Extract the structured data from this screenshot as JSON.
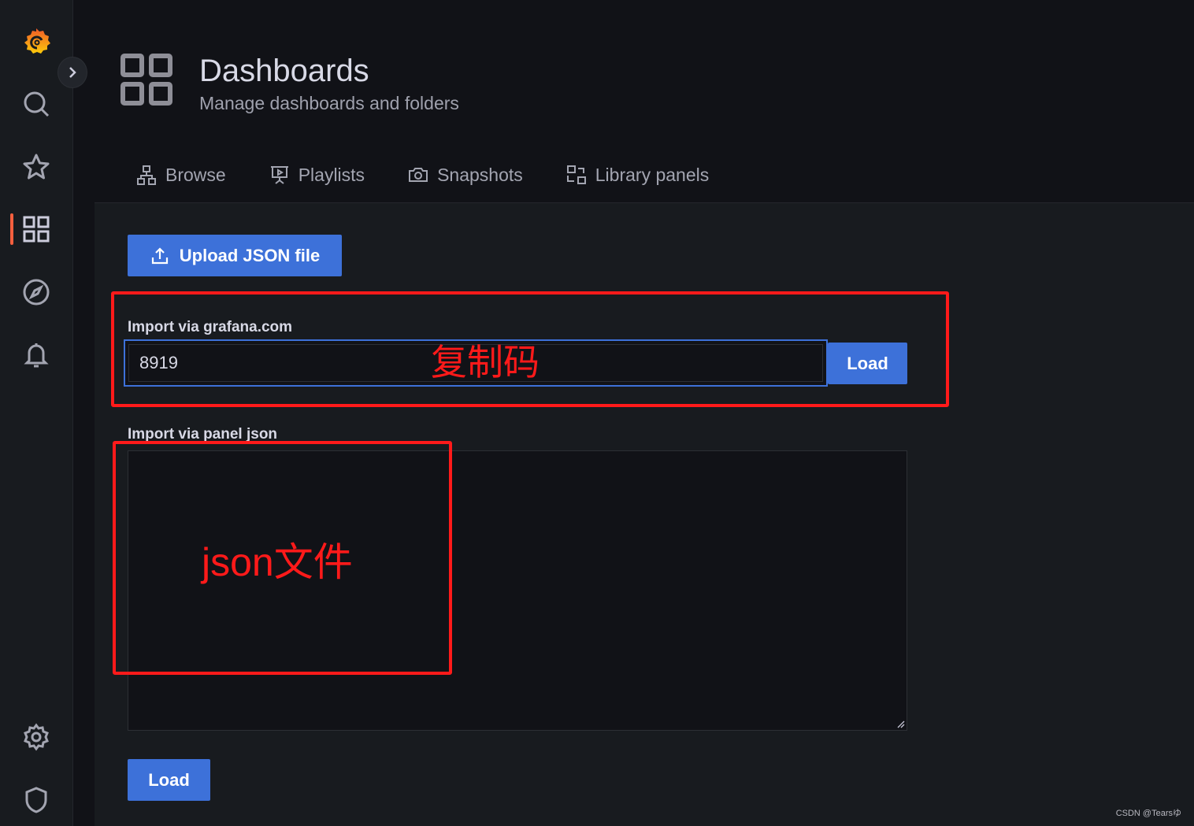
{
  "sidebar": {
    "items": [
      {
        "icon": "grafana-logo-icon"
      },
      {
        "icon": "search-icon"
      },
      {
        "icon": "star-icon"
      },
      {
        "icon": "dashboards-icon",
        "active": true
      },
      {
        "icon": "explore-compass-icon"
      },
      {
        "icon": "alerting-bell-icon"
      },
      {
        "icon": "gear-icon"
      },
      {
        "icon": "shield-icon"
      }
    ],
    "active_color": "#f55f3e"
  },
  "header": {
    "title": "Dashboards",
    "subtitle": "Manage dashboards and folders"
  },
  "tabs": [
    {
      "label": "Browse",
      "icon": "sitemap-icon"
    },
    {
      "label": "Playlists",
      "icon": "presentation-icon"
    },
    {
      "label": "Snapshots",
      "icon": "camera-icon"
    },
    {
      "label": "Library panels",
      "icon": "library-panels-icon"
    }
  ],
  "import": {
    "upload_label": "Upload JSON file",
    "grafana_label": "Import via grafana.com",
    "grafana_value": "8919",
    "grafana_load": "Load",
    "panel_json_label": "Import via panel json",
    "panel_json_value": "",
    "load_label": "Load"
  },
  "annotations": {
    "code_note": "复制码",
    "json_note": "json文件",
    "color": "#ff1a1a"
  },
  "watermark": "CSDN @Tearsゆ",
  "accent": "#3d71d9"
}
